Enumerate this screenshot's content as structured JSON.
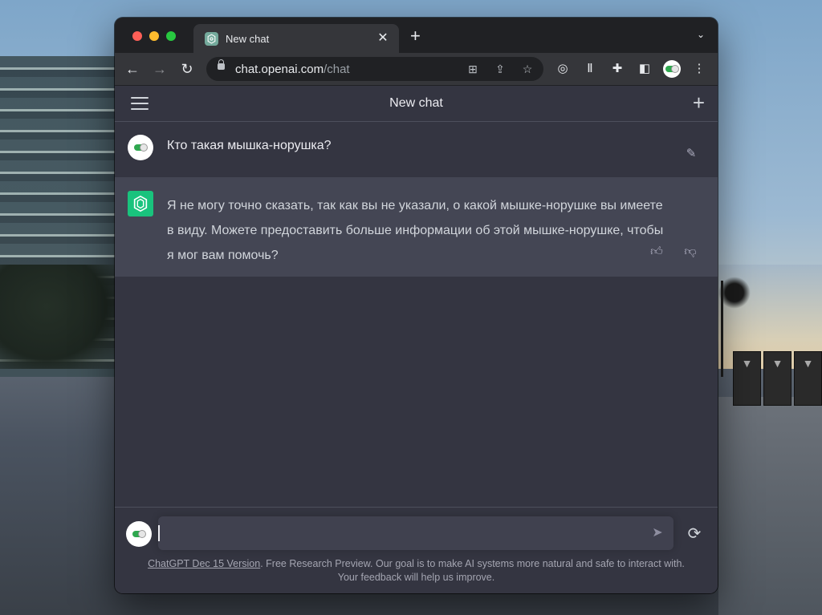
{
  "browser": {
    "tab_title": "New chat",
    "tab_close": "✕",
    "new_tab": "+",
    "url_host": "chat.openai.com",
    "url_path": "/chat"
  },
  "app": {
    "header_title": "New chat"
  },
  "conversation": {
    "user_message": "Кто такая мышка-норушка?",
    "bot_message": "Я не могу точно сказать, так как вы не указали, о какой мышке-норушке вы имеете в виду. Можете предоставить больше информации об этой мышке-норушке, чтобы я мог вам помочь?"
  },
  "composer": {
    "value": "",
    "placeholder": ""
  },
  "footer": {
    "version_link": "ChatGPT Dec 15 Version",
    "text_line1": ". Free Research Preview. Our goal is to make AI systems more natural and safe to interact with.",
    "text_line2": "Your feedback will help us improve."
  },
  "colors": {
    "bot_accent": "#19c37d",
    "bot_bg": "#444654",
    "app_bg": "#343541",
    "input_bg": "#40414f"
  },
  "icons": [
    "back-icon",
    "forward-icon",
    "reload-icon",
    "lock-icon",
    "translate-icon",
    "share-icon",
    "star-icon",
    "extension-icon",
    "puzzle-icon",
    "sidepanel-icon",
    "kebab-icon",
    "hamburger-icon",
    "plus-icon",
    "edit-icon",
    "thumbs-up-icon",
    "thumbs-down-icon",
    "send-icon",
    "regenerate-icon"
  ]
}
